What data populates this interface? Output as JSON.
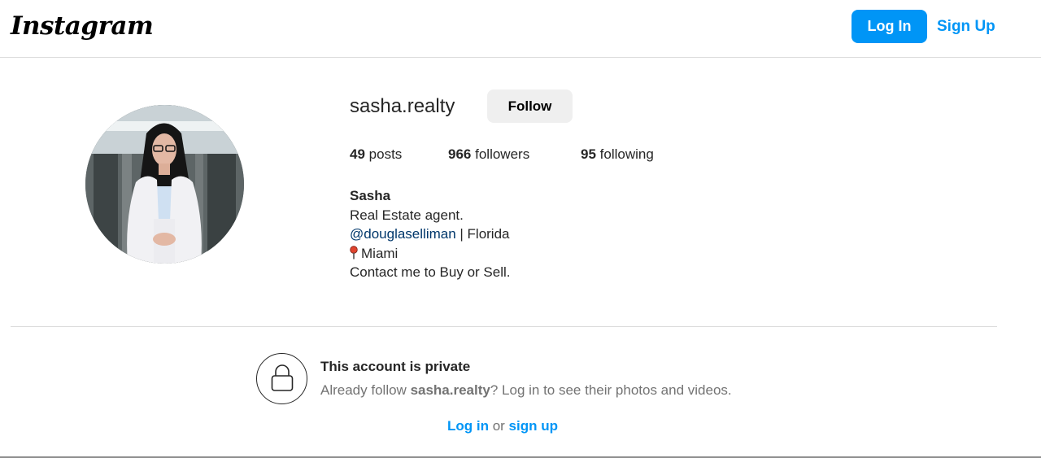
{
  "header": {
    "logo_text": "Instagram",
    "login_label": "Log In",
    "signup_label": "Sign Up"
  },
  "profile": {
    "username": "sasha.realty",
    "follow_label": "Follow",
    "stats": {
      "posts_count": "49",
      "posts_label": "posts",
      "followers_count": "966",
      "followers_label": "followers",
      "following_count": "95",
      "following_label": "following"
    },
    "bio": {
      "name": "Sasha",
      "line1": "Real Estate agent.",
      "mention": "@douglaselliman",
      "mention_suffix": " | Florida",
      "location": "Miami",
      "line4": "Contact me to Buy or Sell."
    }
  },
  "private_notice": {
    "title": "This account is private",
    "desc_prefix": "Already follow ",
    "desc_username": "sasha.realty",
    "desc_suffix": "? Log in to see their photos and videos.",
    "login_link": "Log in",
    "or_text": " or ",
    "signup_link": "sign up"
  },
  "icons": {
    "location": "round-pushpin-icon",
    "private": "lock-icon"
  },
  "colors": {
    "accent": "#0095f6",
    "mention": "#00376b",
    "muted": "#737373",
    "border": "#dbdbdb"
  }
}
